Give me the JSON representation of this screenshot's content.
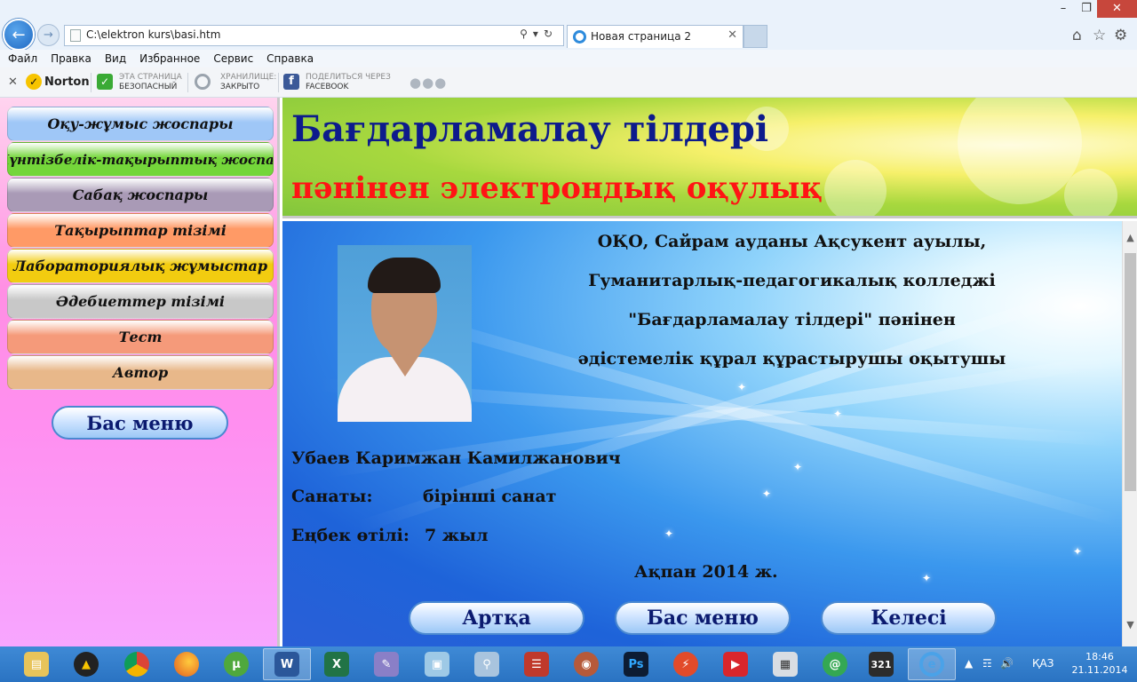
{
  "browser": {
    "url": "C:\\elektron kurs\\basi.htm",
    "tab_title": "Новая страница 2",
    "menu": [
      "Файл",
      "Правка",
      "Вид",
      "Избранное",
      "Сервис",
      "Справка"
    ],
    "toolbar": {
      "norton_label": "Norton",
      "page_status_top": "ЭТА СТРАНИЦА",
      "page_status_bottom": "БЕЗОПАСНЫЙ",
      "vault_top": "ХРАНИЛИЩЕ:",
      "vault_bottom": "ЗАКРЫТО",
      "share_top": "ПОДЕЛИТЬСЯ ЧЕРЕЗ",
      "share_bottom": "FACEBOOK"
    }
  },
  "sidebar": {
    "items": [
      {
        "label": "Оқу-жұмыс жоспары",
        "color": "#9fc7f7"
      },
      {
        "label": "Күнтізбелік-тақырыптық жоспар",
        "color": "#74d63a"
      },
      {
        "label": "Сабақ жоспары",
        "color": "#a99ab6"
      },
      {
        "label": "Тақырыптар тізімі",
        "color": "#ff9a66"
      },
      {
        "label": "Лабораториялық жұмыстар",
        "color": "#f2cc10"
      },
      {
        "label": "Әдебиеттер тізімі",
        "color": "#c8c8c8"
      },
      {
        "label": "Тест",
        "color": "#f59a7a"
      },
      {
        "label": "Автор",
        "color": "#e8b88a"
      }
    ],
    "main_menu_button": "Бас меню"
  },
  "banner": {
    "title": "Бағдарламалау тілдері",
    "subtitle": "пәнінен электрондық оқулық"
  },
  "content": {
    "lines": [
      "ОҚО, Сайрам ауданы Ақсукент ауылы,",
      "Гуманитарлық-педагогикалық колледжі",
      "\"Бағдарламалау тілдері\" пәнінен",
      "әдістемелік құрал құрастырушы оқытушы"
    ],
    "name": "Убаев Каримжан Камилжанович",
    "category_label": "Санаты:",
    "category_value": "бірінші санат",
    "experience_label": "Еңбек өтілі:",
    "experience_value": "7 жыл",
    "date": "Ақпан 2014 ж.",
    "buttons": {
      "back": "Артқа",
      "home": "Бас меню",
      "next": "Келесі"
    }
  },
  "taskbar": {
    "language": "ҚАЗ",
    "time": "18:46",
    "date": "21.11.2014"
  }
}
